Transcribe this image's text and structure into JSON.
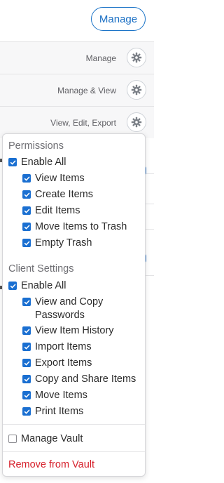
{
  "header": {
    "manage_button_label": "Manage"
  },
  "rows": [
    {
      "label": "Manage",
      "icon": "gear-icon"
    },
    {
      "label": "Manage & View",
      "icon": "gear-icon"
    },
    {
      "label": "View, Edit, Export",
      "icon": "gear-icon"
    }
  ],
  "menu": {
    "permissions": {
      "title": "Permissions",
      "enable_all": {
        "label": "Enable All",
        "checked": true
      },
      "items": [
        {
          "label": "View Items",
          "checked": true
        },
        {
          "label": "Create Items",
          "checked": true
        },
        {
          "label": "Edit Items",
          "checked": true
        },
        {
          "label": "Move Items to Trash",
          "checked": true
        },
        {
          "label": "Empty Trash",
          "checked": true
        }
      ]
    },
    "client_settings": {
      "title": "Client Settings",
      "enable_all": {
        "label": "Enable All",
        "checked": true
      },
      "items": [
        {
          "label": "View and Copy Passwords",
          "checked": true
        },
        {
          "label": "View Item History",
          "checked": true
        },
        {
          "label": "Import Items",
          "checked": true
        },
        {
          "label": "Export Items",
          "checked": true
        },
        {
          "label": "Copy and Share Items",
          "checked": true
        },
        {
          "label": "Move Items",
          "checked": true
        },
        {
          "label": "Print Items",
          "checked": true
        }
      ]
    },
    "manage_vault": {
      "label": "Manage Vault",
      "checked": false
    },
    "remove_label": "Remove from Vault"
  },
  "colors": {
    "accent": "#1a6fd1",
    "danger": "#d6202b"
  }
}
